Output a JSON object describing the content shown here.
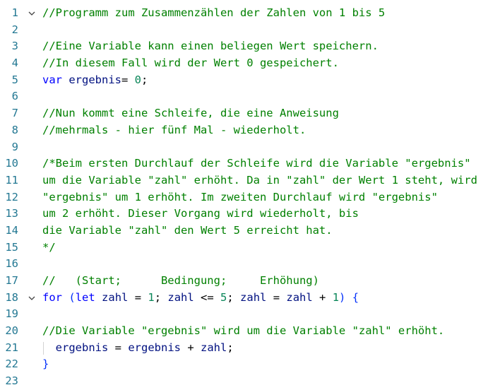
{
  "editor": {
    "lines": [
      {
        "number": "1",
        "fold": true,
        "tokens": [
          {
            "t": "//Programm zum Zusammenzählen der Zahlen von 1 bis 5",
            "c": "comment"
          }
        ]
      },
      {
        "number": "2",
        "tokens": []
      },
      {
        "number": "3",
        "tokens": [
          {
            "t": "//Eine Variable kann einen beliegen Wert speichern.",
            "c": "comment"
          }
        ]
      },
      {
        "number": "4",
        "tokens": [
          {
            "t": "//In diesem Fall wird der Wert 0 gespeichert.",
            "c": "comment"
          }
        ]
      },
      {
        "number": "5",
        "tokens": [
          {
            "t": "var",
            "c": "kw"
          },
          {
            "t": " ",
            "c": "op"
          },
          {
            "t": "ergebnis",
            "c": "ident"
          },
          {
            "t": "= ",
            "c": "op"
          },
          {
            "t": "0",
            "c": "num"
          },
          {
            "t": ";",
            "c": "op"
          }
        ]
      },
      {
        "number": "6",
        "tokens": []
      },
      {
        "number": "7",
        "tokens": [
          {
            "t": "//Nun kommt eine Schleife, die eine Anweisung",
            "c": "comment"
          }
        ]
      },
      {
        "number": "8",
        "tokens": [
          {
            "t": "//mehrmals - hier fünf Mal - wiederholt.",
            "c": "comment"
          }
        ]
      },
      {
        "number": "9",
        "tokens": []
      },
      {
        "number": "10",
        "tokens": [
          {
            "t": "/*Beim ersten Durchlauf der Schleife wird die Variable \"ergebnis\"",
            "c": "comment"
          }
        ]
      },
      {
        "number": "11",
        "tokens": [
          {
            "t": "um die Variable \"zahl\" erhöht. Da in \"zahl\" der Wert 1 steht, wird",
            "c": "comment"
          }
        ]
      },
      {
        "number": "12",
        "tokens": [
          {
            "t": "\"ergebnis\" um 1 erhöht. Im zweiten Durchlauf wird \"ergebnis\"",
            "c": "comment"
          }
        ]
      },
      {
        "number": "13",
        "tokens": [
          {
            "t": "um 2 erhöht. Dieser Vorgang wird wiederholt, bis",
            "c": "comment"
          }
        ]
      },
      {
        "number": "14",
        "tokens": [
          {
            "t": "die Variable \"zahl\" den Wert 5 erreicht hat.",
            "c": "comment"
          }
        ]
      },
      {
        "number": "15",
        "tokens": [
          {
            "t": "*/",
            "c": "comment"
          }
        ]
      },
      {
        "number": "16",
        "tokens": []
      },
      {
        "number": "17",
        "tokens": [
          {
            "t": "//   (Start;      Bedingung;     Erhöhung)",
            "c": "comment"
          }
        ]
      },
      {
        "number": "18",
        "fold": true,
        "tokens": [
          {
            "t": "for",
            "c": "kw"
          },
          {
            "t": " ",
            "c": "op"
          },
          {
            "t": "(",
            "c": "paren"
          },
          {
            "t": "let",
            "c": "kw"
          },
          {
            "t": " ",
            "c": "op"
          },
          {
            "t": "zahl",
            "c": "ident"
          },
          {
            "t": " = ",
            "c": "op"
          },
          {
            "t": "1",
            "c": "num"
          },
          {
            "t": "; ",
            "c": "op"
          },
          {
            "t": "zahl",
            "c": "ident"
          },
          {
            "t": " <= ",
            "c": "op"
          },
          {
            "t": "5",
            "c": "num"
          },
          {
            "t": "; ",
            "c": "op"
          },
          {
            "t": "zahl",
            "c": "ident"
          },
          {
            "t": " = ",
            "c": "op"
          },
          {
            "t": "zahl",
            "c": "ident"
          },
          {
            "t": " + ",
            "c": "op"
          },
          {
            "t": "1",
            "c": "num"
          },
          {
            "t": ")",
            "c": "paren"
          },
          {
            "t": " ",
            "c": "op"
          },
          {
            "t": "{",
            "c": "brace"
          }
        ]
      },
      {
        "number": "19",
        "tokens": []
      },
      {
        "number": "20",
        "tokens": [
          {
            "t": "//Die Variable \"ergebnis\" wird um die Variable \"zahl\" erhöht.",
            "c": "comment"
          }
        ]
      },
      {
        "number": "21",
        "guide": true,
        "tokens": [
          {
            "t": "  ",
            "c": "op"
          },
          {
            "t": "ergebnis",
            "c": "ident"
          },
          {
            "t": " = ",
            "c": "op"
          },
          {
            "t": "ergebnis",
            "c": "ident"
          },
          {
            "t": " + ",
            "c": "op"
          },
          {
            "t": "zahl",
            "c": "ident"
          },
          {
            "t": ";",
            "c": "op"
          }
        ]
      },
      {
        "number": "22",
        "tokens": [
          {
            "t": "}",
            "c": "brace"
          }
        ]
      },
      {
        "number": "23",
        "tokens": []
      }
    ],
    "colors": {
      "line_number": "#237893",
      "comment": "#008000",
      "keyword": "#0000ff",
      "number": "#098658",
      "identifier": "#001080",
      "fold_icon": "chevron-down-icon"
    }
  }
}
